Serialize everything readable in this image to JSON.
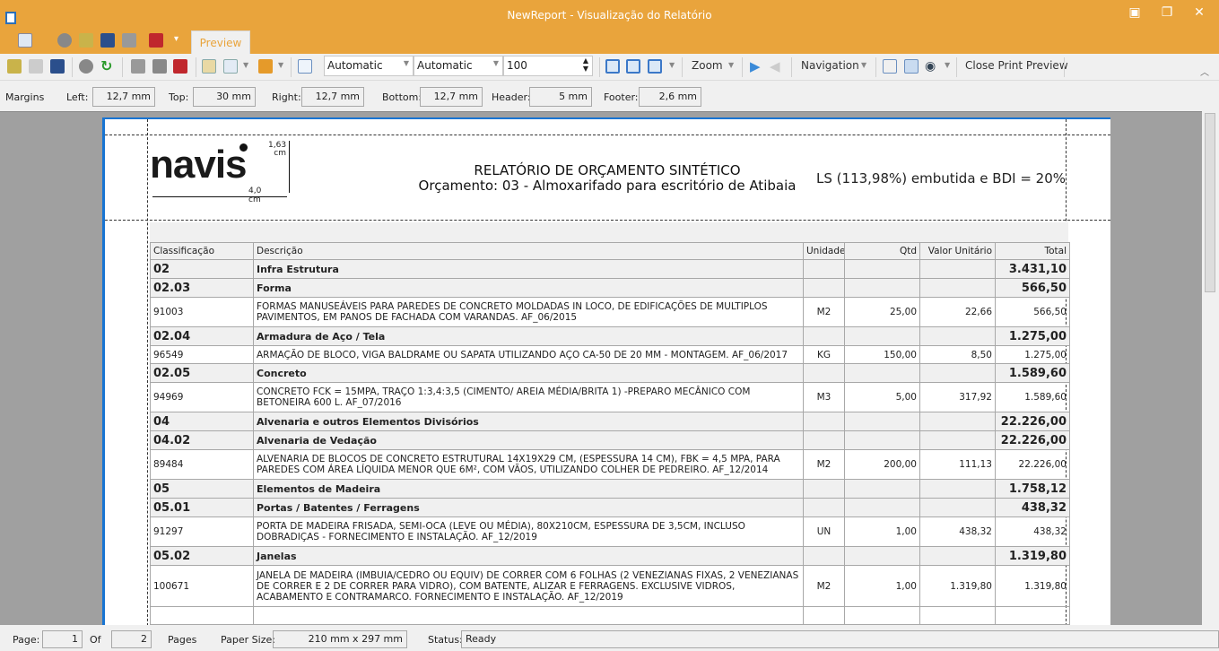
{
  "window": {
    "title": "NewReport - Visualização do Relatório"
  },
  "ribbon": {
    "tab": "Preview"
  },
  "toolbar": {
    "combo1": "Automatic",
    "combo2": "Automatic",
    "zoom_value": "100",
    "zoom_label": "Zoom",
    "navigation_label": "Navigation",
    "close_label": "Close Print Preview"
  },
  "margins": {
    "label": "Margins",
    "left_label": "Left:",
    "left": "12,7 mm",
    "top_label": "Top:",
    "top": "30 mm",
    "right_label": "Right:",
    "right": "12,7 mm",
    "bottom_label": "Bottom:",
    "bottom": "12,7 mm",
    "header_label": "Header:",
    "header": "5 mm",
    "footer_label": "Footer:",
    "footer": "2,6 mm"
  },
  "report": {
    "logo": {
      "text": "navis",
      "height_note": "1,63",
      "height_unit": "cm",
      "width_note": "4,0 cm"
    },
    "title": "RELATÓRIO DE ORÇAMENTO SINTÉTICO",
    "subtitle": "Orçamento: 03 - Almoxarifado para escritório de Atibaia",
    "note": "LS (113,98%) embutida e BDI = 20%",
    "columns": [
      "Classificação",
      "Descrição",
      "Unidade",
      "Qtd",
      "Valor Unitário",
      "Total"
    ],
    "rows": [
      {
        "group": true,
        "cls": "02",
        "desc": "Infra Estrutura",
        "un": "",
        "qtd": "",
        "vu": "",
        "total": "3.431,10"
      },
      {
        "group": true,
        "cls": "02.03",
        "desc": "Forma",
        "un": "",
        "qtd": "",
        "vu": "",
        "total": "566,50"
      },
      {
        "group": false,
        "cls": "91003",
        "desc": "FORMAS MANUSEÁVEIS PARA PAREDES DE CONCRETO MOLDADAS IN LOCO, DE EDIFICAÇÕES DE MULTIPLOS PAVIMENTOS, EM PANOS DE FACHADA COM VARANDAS. AF_06/2015",
        "un": "M2",
        "qtd": "25,00",
        "vu": "22,66",
        "total": "566,50"
      },
      {
        "group": true,
        "cls": "02.04",
        "desc": "Armadura de Aço / Tela",
        "un": "",
        "qtd": "",
        "vu": "",
        "total": "1.275,00"
      },
      {
        "group": false,
        "cls": "96549",
        "desc": "ARMAÇÃO DE BLOCO, VIGA BALDRAME OU SAPATA UTILIZANDO AÇO CA-50 DE 20 MM - MONTAGEM. AF_06/2017",
        "un": "KG",
        "qtd": "150,00",
        "vu": "8,50",
        "total": "1.275,00"
      },
      {
        "group": true,
        "cls": "02.05",
        "desc": "Concreto",
        "un": "",
        "qtd": "",
        "vu": "",
        "total": "1.589,60"
      },
      {
        "group": false,
        "cls": "94969",
        "desc": "CONCRETO FCK = 15MPA, TRAÇO 1:3,4:3,5 (CIMENTO/ AREIA MÉDIA/BRITA 1)  -PREPARO MECÂNICO COM BETONEIRA 600 L. AF_07/2016",
        "un": "M3",
        "qtd": "5,00",
        "vu": "317,92",
        "total": "1.589,60"
      },
      {
        "group": true,
        "cls": "04",
        "desc": "Alvenaria e outros Elementos Divisórios",
        "un": "",
        "qtd": "",
        "vu": "",
        "total": "22.226,00"
      },
      {
        "group": true,
        "cls": "04.02",
        "desc": "Alvenaria de Vedação",
        "un": "",
        "qtd": "",
        "vu": "",
        "total": "22.226,00"
      },
      {
        "group": false,
        "cls": "89484",
        "desc": "ALVENARIA DE BLOCOS DE CONCRETO ESTRUTURAL 14X19X29 CM, (ESPESSURA 14 CM), FBK = 4,5 MPA, PARA PAREDES COM ÁREA LÍQUIDA MENOR QUE 6M², COM VÃOS, UTILIZANDO COLHER DE PEDREIRO. AF_12/2014",
        "un": "M2",
        "qtd": "200,00",
        "vu": "111,13",
        "total": "22.226,00"
      },
      {
        "group": true,
        "cls": "05",
        "desc": "Elementos de Madeira",
        "un": "",
        "qtd": "",
        "vu": "",
        "total": "1.758,12"
      },
      {
        "group": true,
        "cls": "05.01",
        "desc": "Portas / Batentes / Ferragens",
        "un": "",
        "qtd": "",
        "vu": "",
        "total": "438,32"
      },
      {
        "group": false,
        "cls": "91297",
        "desc": "PORTA DE MADEIRA FRISADA, SEMI-OCA (LEVE OU MÉDIA), 80X210CM, ESPESSURA DE 3,5CM, INCLUSO DOBRADIÇAS - FORNECIMENTO E INSTALAÇÃO. AF_12/2019",
        "un": "UN",
        "qtd": "1,00",
        "vu": "438,32",
        "total": "438,32"
      },
      {
        "group": true,
        "cls": "05.02",
        "desc": "Janelas",
        "un": "",
        "qtd": "",
        "vu": "",
        "total": "1.319,80"
      },
      {
        "group": false,
        "cls": "100671",
        "desc": "JANELA DE MADEIRA (IMBUIA/CEDRO OU EQUIV) DE CORRER COM 6 FOLHAS (2 VENEZIANAS FIXAS, 2 VENEZIANAS DE CORRER E 2 DE CORRER PARA VIDRO), COM BATENTE, ALIZAR E FERRAGENS. EXCLUSIVE VIDROS, ACABAMENTO E CONTRAMARCO. FORNECIMENTO E INSTALAÇÃO. AF_12/2019",
        "un": "M2",
        "qtd": "1,00",
        "vu": "1.319,80",
        "total": "1.319,80"
      }
    ]
  },
  "statusbar": {
    "page_label": "Page:",
    "page": "1",
    "of_label": "Of",
    "pages": "2",
    "pages_label": "Pages",
    "paper_label": "Paper Size:",
    "paper": "210 mm x 297 mm",
    "status_label": "Status:",
    "status": "Ready"
  },
  "colors": {
    "accent": "#e9a43c",
    "page_border": "#1874d2"
  }
}
